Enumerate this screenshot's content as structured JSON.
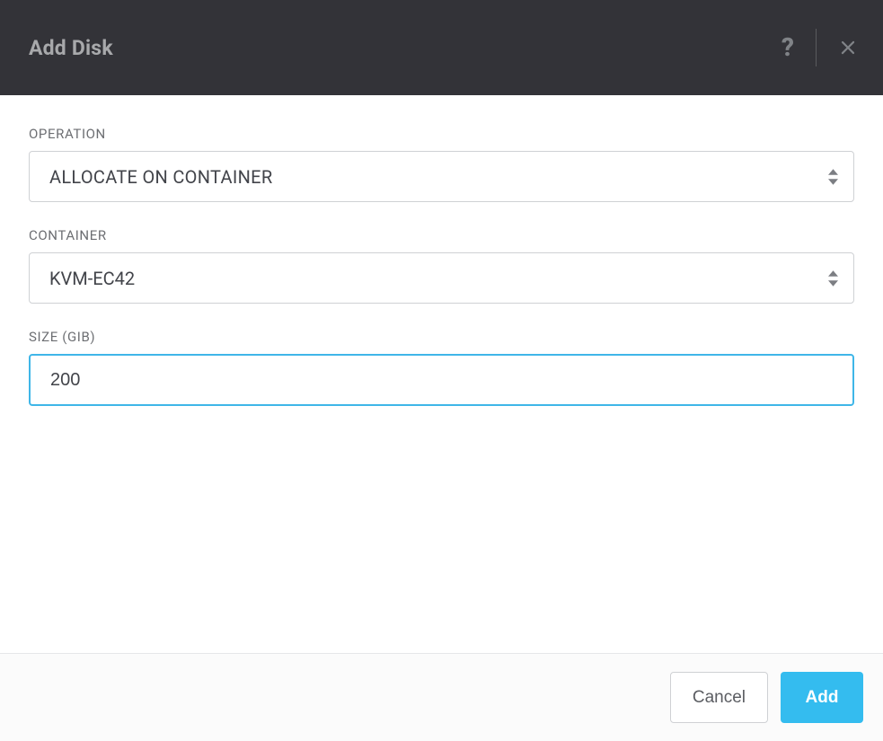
{
  "header": {
    "title": "Add Disk"
  },
  "form": {
    "operation": {
      "label": "OPERATION",
      "value": "ALLOCATE ON CONTAINER"
    },
    "container": {
      "label": "CONTAINER",
      "value": "KVM-EC42"
    },
    "size": {
      "label": "SIZE (GIB)",
      "value": "200"
    }
  },
  "footer": {
    "cancel_label": "Cancel",
    "add_label": "Add"
  }
}
